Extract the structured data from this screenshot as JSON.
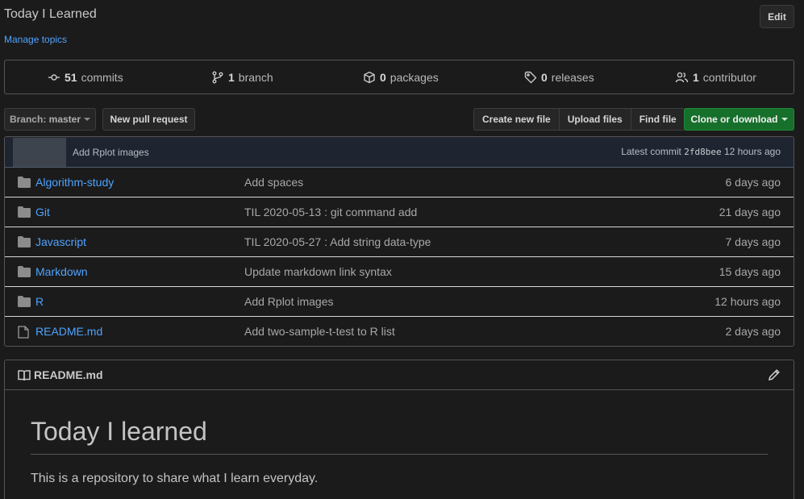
{
  "repo": {
    "title": "Today I Learned",
    "manage_topics": "Manage topics",
    "edit_label": "Edit"
  },
  "stats": {
    "commits": {
      "count": "51",
      "label": "commits"
    },
    "branches": {
      "count": "1",
      "label": "branch"
    },
    "packages": {
      "count": "0",
      "label": "packages"
    },
    "releases": {
      "count": "0",
      "label": "releases"
    },
    "contributors": {
      "count": "1",
      "label": "contributor"
    }
  },
  "toolbar": {
    "branch_prefix": "Branch:",
    "branch_name": "master",
    "new_pull_request": "New pull request",
    "create_new_file": "Create new file",
    "upload_files": "Upload files",
    "find_file": "Find file",
    "clone_or_download": "Clone or download"
  },
  "latest_commit": {
    "message": "Add Rplot images",
    "prefix": "Latest commit",
    "sha": "2fd8bee",
    "age": "12 hours ago"
  },
  "files": [
    {
      "name": "Algorithm-study",
      "type": "folder",
      "message": "Add spaces",
      "age": "6 days ago"
    },
    {
      "name": "Git",
      "type": "folder",
      "message": "TIL 2020-05-13 : git command add",
      "age": "21 days ago"
    },
    {
      "name": "Javascript",
      "type": "folder",
      "message": "TIL 2020-05-27 : Add string data-type",
      "age": "7 days ago"
    },
    {
      "name": "Markdown",
      "type": "folder",
      "message": "Update markdown link syntax",
      "age": "15 days ago"
    },
    {
      "name": "R",
      "type": "folder",
      "message": "Add Rplot images",
      "age": "12 hours ago"
    },
    {
      "name": "README.md",
      "type": "file",
      "message": "Add two-sample-t-test to R list",
      "age": "2 days ago"
    }
  ],
  "readme": {
    "filename": "README.md",
    "heading": "Today I learned",
    "paragraph": "This is a repository to share what I learn everyday."
  },
  "colors": {
    "link": "#4ea3ff",
    "clone_button": "#176f2c",
    "background": "#1b1b1b"
  }
}
